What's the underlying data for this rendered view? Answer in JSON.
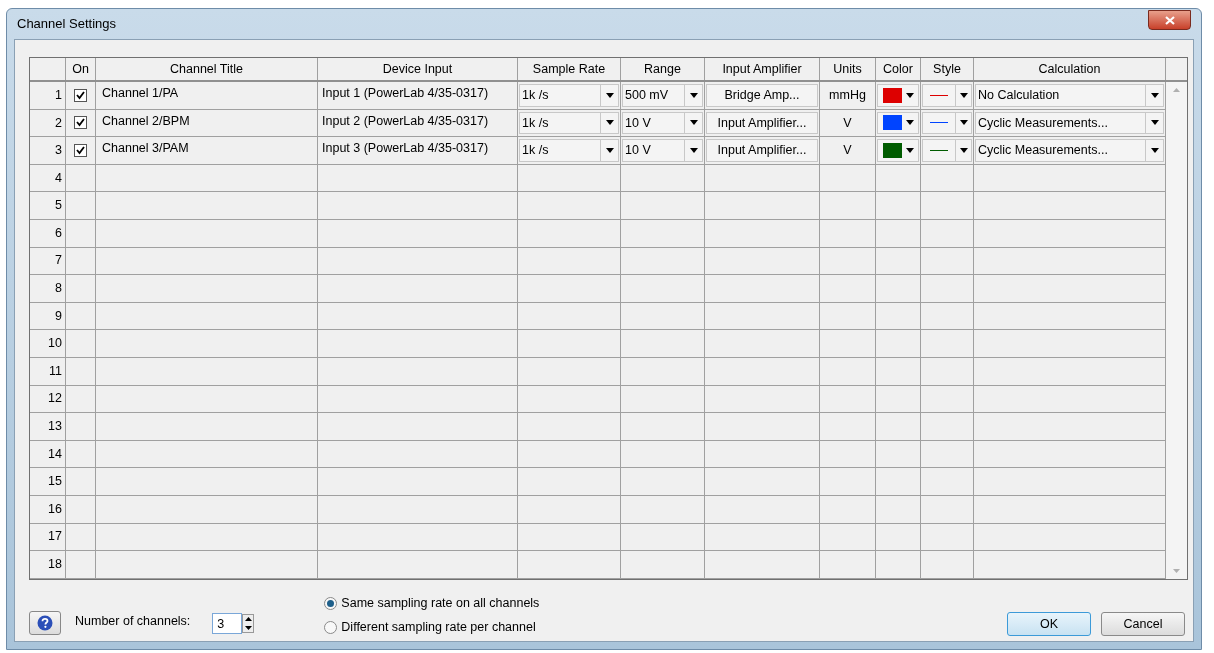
{
  "window": {
    "title": "Channel Settings"
  },
  "table": {
    "columns": [
      "On",
      "Channel Title",
      "Device Input",
      "Sample Rate",
      "Range",
      "Input Amplifier",
      "Units",
      "Color",
      "Style",
      "Calculation"
    ],
    "rows": [
      {
        "number": "1",
        "on": true,
        "title": "Channel 1/PA",
        "device": "Input 1 (PowerLab 4/35-0317)",
        "sample_rate": "1k /s",
        "range": "500 mV",
        "amplifier": "Bridge Amp...",
        "units": "mmHg",
        "color": "#dd0000",
        "calculation": "No Calculation"
      },
      {
        "number": "2",
        "on": true,
        "title": "Channel 2/BPM",
        "device": "Input 2 (PowerLab 4/35-0317)",
        "sample_rate": "1k /s",
        "range": "10 V",
        "amplifier": "Input Amplifier...",
        "units": "V",
        "color": "#0044ff",
        "calculation": "Cyclic Measurements..."
      },
      {
        "number": "3",
        "on": true,
        "title": "Channel 3/PAM",
        "device": "Input 3 (PowerLab 4/35-0317)",
        "sample_rate": "1k /s",
        "range": "10 V",
        "amplifier": "Input Amplifier...",
        "units": "V",
        "color": "#005c00",
        "calculation": "Cyclic Measurements..."
      },
      {
        "number": "4"
      },
      {
        "number": "5"
      },
      {
        "number": "6"
      },
      {
        "number": "7"
      },
      {
        "number": "8"
      },
      {
        "number": "9"
      },
      {
        "number": "10"
      },
      {
        "number": "11"
      },
      {
        "number": "12"
      },
      {
        "number": "13"
      },
      {
        "number": "14"
      },
      {
        "number": "15"
      },
      {
        "number": "16"
      },
      {
        "number": "17"
      },
      {
        "number": "18"
      }
    ]
  },
  "footer": {
    "channels_label": "Number of channels:",
    "channels_value": "3",
    "sampling_options": [
      {
        "label": "Same sampling rate on all channels",
        "selected": true
      },
      {
        "label": "Different sampling rate per channel",
        "selected": false
      }
    ],
    "buttons": [
      "OK",
      "Cancel"
    ]
  }
}
